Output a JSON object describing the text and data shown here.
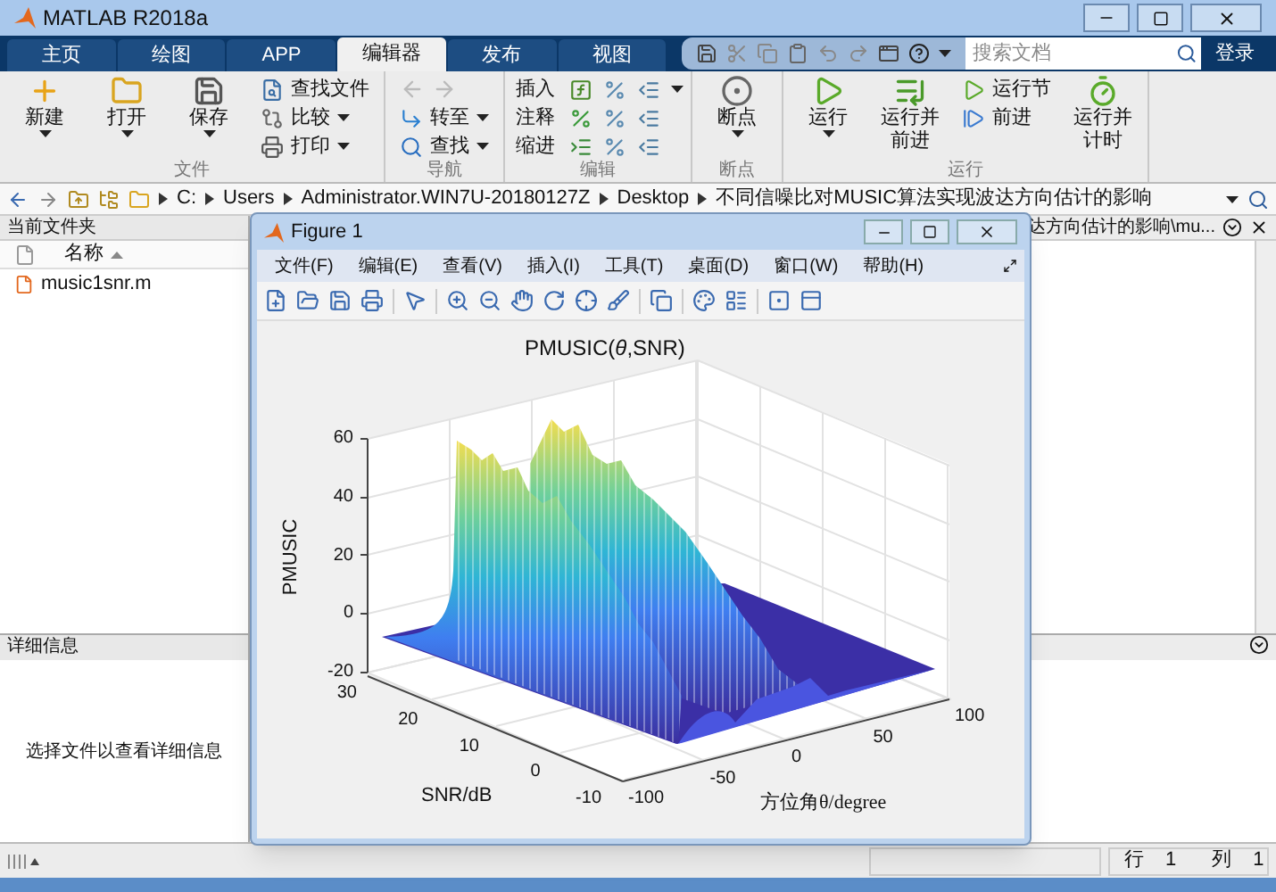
{
  "window": {
    "title": "MATLAB R2018a"
  },
  "tabs": [
    {
      "label": "主页",
      "selected": false
    },
    {
      "label": "绘图",
      "selected": false
    },
    {
      "label": "APP",
      "selected": false
    },
    {
      "label": "编辑器",
      "selected": true
    },
    {
      "label": "发布",
      "selected": false
    },
    {
      "label": "视图",
      "selected": false
    }
  ],
  "search": {
    "placeholder": "搜索文档"
  },
  "login": "登录",
  "toolstrip": [
    {
      "label": "文件",
      "items": [
        {
          "kind": "big",
          "label": "新建",
          "dropdown": true
        },
        {
          "kind": "big",
          "label": "打开",
          "dropdown": true
        },
        {
          "kind": "big",
          "label": "保存",
          "dropdown": true
        },
        {
          "kind": "small",
          "label": "查找文件",
          "dropdown": false
        },
        {
          "kind": "small",
          "label": "比较",
          "dropdown": true
        },
        {
          "kind": "small",
          "label": "打印",
          "dropdown": true
        }
      ]
    },
    {
      "label": "导航",
      "items": [
        {
          "kind": "arrows"
        },
        {
          "kind": "small",
          "label": "转至",
          "dropdown": true
        },
        {
          "kind": "small",
          "label": "查找",
          "dropdown": true
        }
      ]
    },
    {
      "label": "编辑",
      "items": [
        {
          "kind": "row",
          "label": "插入",
          "dropdown": true
        },
        {
          "kind": "row",
          "label": "注释",
          "dropdown": false
        },
        {
          "kind": "row",
          "label": "缩进",
          "dropdown": false
        }
      ]
    },
    {
      "label": "断点",
      "items": [
        {
          "kind": "big",
          "label": "断点",
          "dropdown": true
        }
      ]
    },
    {
      "label": "运行",
      "items": [
        {
          "kind": "big",
          "label": "运行",
          "dropdown": true
        },
        {
          "kind": "big",
          "label": "运行并前进",
          "dropdown": false
        },
        {
          "kind": "small",
          "label": "运行节",
          "dropdown": false
        },
        {
          "kind": "small",
          "label": "前进",
          "dropdown": false
        },
        {
          "kind": "big",
          "label": "运行并计时",
          "dropdown": false
        }
      ]
    }
  ],
  "path": [
    "C:",
    "Users",
    "Administrator.WIN7U-20180127Z",
    "Desktop",
    "不同信噪比对MUSIC算法实现波达方向估计的影响"
  ],
  "current_folder": {
    "title": "当前文件夹",
    "column": "名称",
    "files": [
      "music1snr.m"
    ]
  },
  "details": {
    "title": "详细信息",
    "message": "选择文件以查看详细信息"
  },
  "editor": {
    "tab_text": "达方向估计的影响\\mu..."
  },
  "figure": {
    "title": "Figure 1",
    "menus": [
      "文件(F)",
      "编辑(E)",
      "查看(V)",
      "插入(I)",
      "工具(T)",
      "桌面(D)",
      "窗口(W)",
      "帮助(H)"
    ],
    "plot": {
      "title": "PMUSIC(*θ*,SNR)",
      "zlabel": "PMUSIC",
      "ylabel": "SNR/dB",
      "xlabel": "方位角θ/degree",
      "zticks": [
        "60",
        "40",
        "20",
        "0",
        "-20"
      ],
      "yticks": [
        "30",
        "20",
        "10",
        "0",
        "-10"
      ],
      "xticks": [
        "-100",
        "-50",
        "0",
        "50",
        "100"
      ]
    }
  },
  "status_bar": {
    "row_label": "行",
    "row": "1",
    "col_label": "列",
    "col": "1"
  }
}
